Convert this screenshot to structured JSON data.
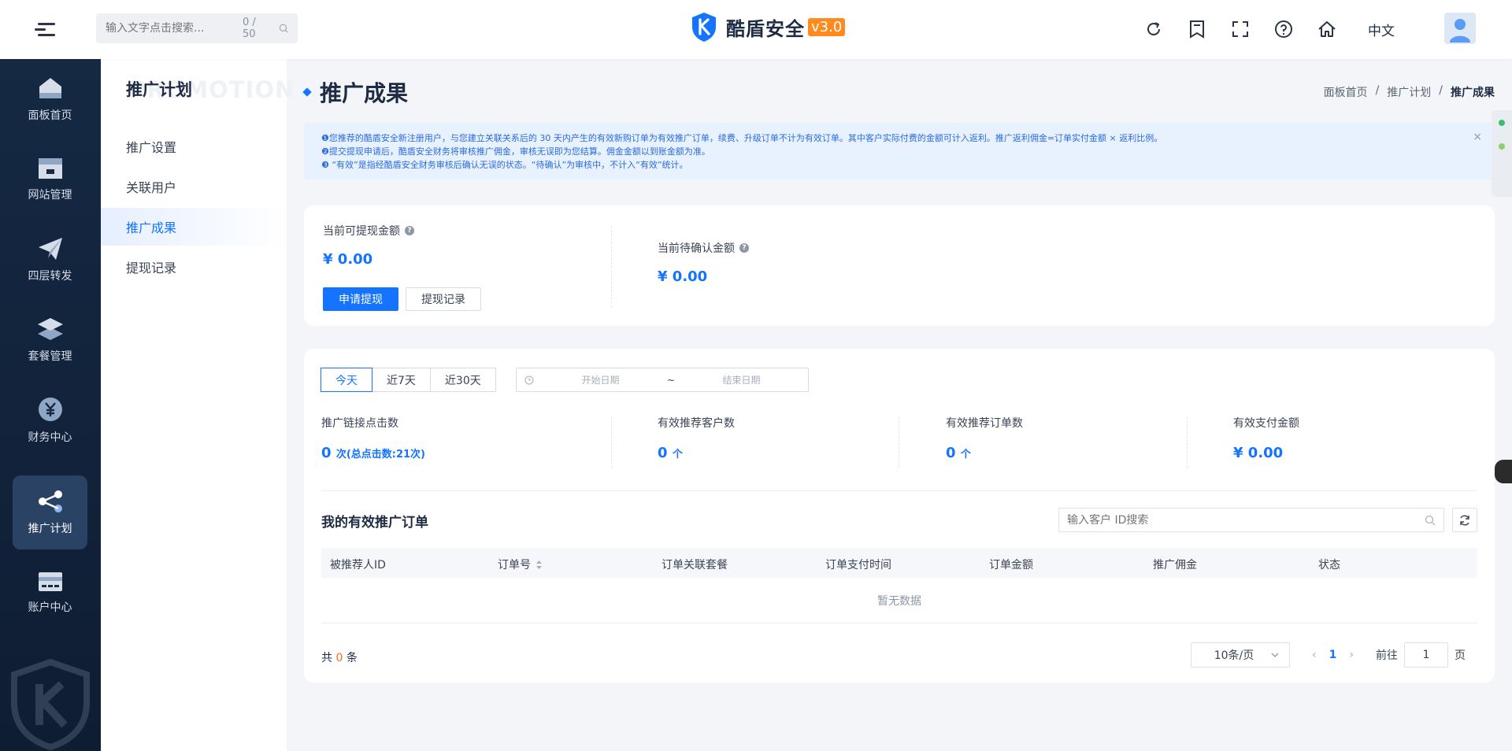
{
  "header": {
    "search_placeholder": "输入文字点击搜索...",
    "search_count": "0 / 50",
    "brand": "酷盾安全",
    "version": "v3.0",
    "language": "中文"
  },
  "sidebar": {
    "items": [
      {
        "label": "面板首页",
        "icon": "dashboard-icon"
      },
      {
        "label": "网站管理",
        "icon": "website-icon"
      },
      {
        "label": "四层转发",
        "icon": "send-icon"
      },
      {
        "label": "套餐管理",
        "icon": "layers-icon"
      },
      {
        "label": "财务中心",
        "icon": "yuan-icon"
      },
      {
        "label": "推广计划",
        "icon": "share-icon",
        "active": true
      },
      {
        "label": "账户中心",
        "icon": "card-icon"
      }
    ]
  },
  "subsidebar": {
    "title": "推广计划",
    "ghost": "PROMOTION",
    "items": [
      "推广设置",
      "关联用户",
      "推广成果",
      "提现记录"
    ],
    "active_index": 2
  },
  "page": {
    "title": "推广成果",
    "breadcrumb": [
      "面板首页",
      "推广计划",
      "推广成果"
    ]
  },
  "notice": {
    "lines": [
      "❶您推荐的酷盾安全新注册用户，与您建立关联关系后的 30 天内产生的有效新购订单为有效推广订单，续费、升级订单不计为有效订单。其中客户实际付费的金额可计入返利。推广返利佣金=订单实付金额 × 返利比例。",
      "❷提交提现申请后，酷盾安全财务将审核推广佣金，审核无误即为您结算。佣金金额以到账金额为准。",
      "❸ “有效”是指经酷盾安全财务审核后确认无误的状态。“待确认”为审核中，不计入“有效”统计。"
    ],
    "close": "×"
  },
  "balance": {
    "withdrawable_label": "当前可提现金额",
    "withdrawable_value": "¥ 0.00",
    "pending_label": "当前待确认金额",
    "pending_value": "¥ 0.00",
    "apply_button": "申请提现",
    "records_button": "提现记录"
  },
  "filters": {
    "tabs": [
      "今天",
      "近7天",
      "近30天"
    ],
    "active_tab": 0,
    "start_placeholder": "开始日期",
    "separator": "~",
    "end_placeholder": "结束日期"
  },
  "stats": [
    {
      "label": "推广链接点击数",
      "value": "0",
      "unit": "次(总点击数:21次)"
    },
    {
      "label": "有效推荐客户数",
      "value": "0",
      "unit": "个"
    },
    {
      "label": "有效推荐订单数",
      "value": "0",
      "unit": "个"
    },
    {
      "label": "有效支付金额",
      "value": "¥ 0.00",
      "unit": ""
    }
  ],
  "table": {
    "title": "我的有效推广订单",
    "search_placeholder": "输入客户 ID搜索",
    "columns": [
      "被推荐人ID",
      "订单号",
      "订单关联套餐",
      "订单支付时间",
      "订单金额",
      "推广佣金",
      "状态"
    ],
    "empty_text": "暂无数据",
    "total_prefix": "共",
    "total_count": "0",
    "total_suffix": "条",
    "page_size": "10条/页",
    "current_page": "1",
    "goto_prefix": "前往",
    "goto_value": "1",
    "goto_suffix": "页"
  },
  "colors": {
    "primary": "#1474ff",
    "sidebar_bg": "#152943",
    "accent_orange": "#ff8a1e"
  }
}
